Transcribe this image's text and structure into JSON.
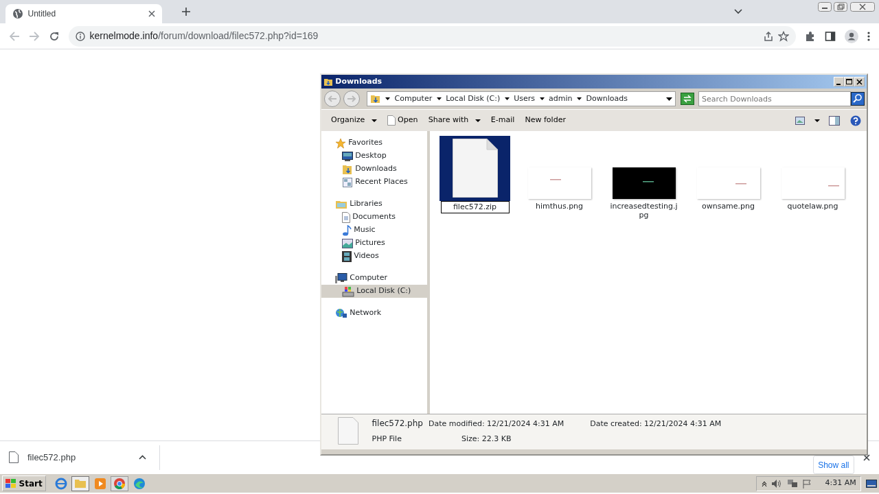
{
  "browser": {
    "tab": {
      "title": "Untitled"
    },
    "address": {
      "domain": "kernelmode.info",
      "path": "/forum/download/filec572.php?id=169"
    }
  },
  "explorer": {
    "title": "Downloads",
    "breadcrumb": [
      "Computer",
      "Local Disk (C:)",
      "Users",
      "admin",
      "Downloads"
    ],
    "search": {
      "placeholder": "Search Downloads"
    },
    "commands": [
      {
        "label": "Organize",
        "kind": "menu"
      },
      {
        "label": "Open",
        "kind": "document"
      },
      {
        "label": "Share with",
        "kind": "menu"
      },
      {
        "label": "E-mail",
        "kind": "plain"
      },
      {
        "label": "New folder",
        "kind": "plain"
      }
    ],
    "nav": [
      {
        "label": "Favorites",
        "kind": "star",
        "selected": false,
        "children": [
          {
            "label": "Desktop",
            "kind": "desktop",
            "selected": false
          },
          {
            "label": "Downloads",
            "kind": "downloads",
            "selected": false
          },
          {
            "label": "Recent Places",
            "kind": "recent",
            "selected": false
          }
        ]
      },
      {
        "label": "Libraries",
        "kind": "library",
        "selected": false,
        "children": [
          {
            "label": "Documents",
            "kind": "documents",
            "selected": false
          },
          {
            "label": "Music",
            "kind": "music",
            "selected": false
          },
          {
            "label": "Pictures",
            "kind": "pictures",
            "selected": false
          },
          {
            "label": "Videos",
            "kind": "videos",
            "selected": false
          }
        ]
      },
      {
        "label": "Computer",
        "kind": "computer",
        "selected": false,
        "children": [
          {
            "label": "Local Disk (C:)",
            "kind": "disk",
            "selected": true
          }
        ]
      },
      {
        "label": "Network",
        "kind": "network",
        "selected": false
      }
    ],
    "files": [
      {
        "name": "filec572.zip",
        "kind": "document",
        "selected": true
      },
      {
        "name": "himthus.png",
        "kind": "picture",
        "color": "#ffffff",
        "selected": false
      },
      {
        "name": "increasedtesting.jpg",
        "kind": "picture",
        "color": "#000000",
        "selected": false
      },
      {
        "name": "ownsame.png",
        "kind": "picture",
        "color": "#ffffff",
        "selected": false
      },
      {
        "name": "quotelaw.png",
        "kind": "picture",
        "color": "#ffffff",
        "selected": false
      }
    ],
    "details": {
      "name": "filec572.php",
      "type": "PHP File",
      "modified": {
        "label": "Date modified:",
        "value": "12/21/2024 4:31 AM"
      },
      "created": {
        "label": "Date created:",
        "value": "12/21/2024 4:31 AM"
      },
      "size": {
        "label": "Size:",
        "value": "22.3 KB"
      }
    }
  },
  "downloads": {
    "file": "filec572.php",
    "show_all": "Show all"
  },
  "taskbar": {
    "start": "Start",
    "time": "4:31 AM"
  }
}
